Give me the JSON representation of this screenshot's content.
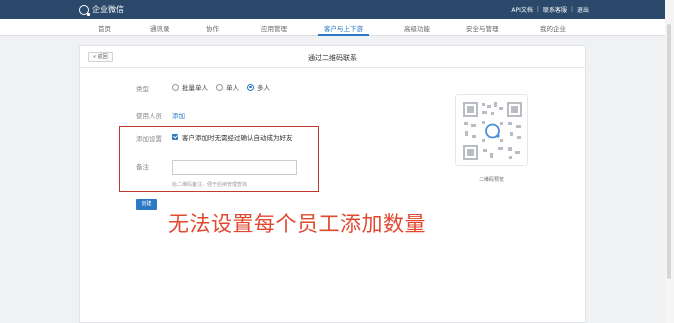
{
  "app": {
    "logo_text": "企业微信"
  },
  "top_links": [
    "API文档",
    "联系客服",
    "退出"
  ],
  "nav": {
    "items": [
      "首页",
      "通讯录",
      "协作",
      "应用管理",
      "客户与上下游",
      "高级功能",
      "安全与管理",
      "我的企业"
    ],
    "active_index": 4
  },
  "panel": {
    "back_label": "返回",
    "title": "通过二维码联系"
  },
  "form": {
    "type_label": "类型",
    "type_options": [
      "批量单人",
      "单人",
      "多人"
    ],
    "type_selected": "多人",
    "member_label": "使用人员",
    "member_link": "添加",
    "add_setting_label": "添加设置",
    "add_setting_checkbox": "客户添加时无需经过确认自动成为好友",
    "add_setting_checked": true,
    "note_label": "备注",
    "note_value": "",
    "note_hint": "给二维码备注，便于后续管理查找",
    "create_label": "创建"
  },
  "qr": {
    "caption": "二维码预览"
  },
  "annotation": {
    "text": "无法设置每个员工添加数量",
    "color": "#e0482f"
  },
  "colors": {
    "topbar": "#2b4a6b",
    "accent": "#2b78c5",
    "annotation_box": "#c0392b"
  }
}
